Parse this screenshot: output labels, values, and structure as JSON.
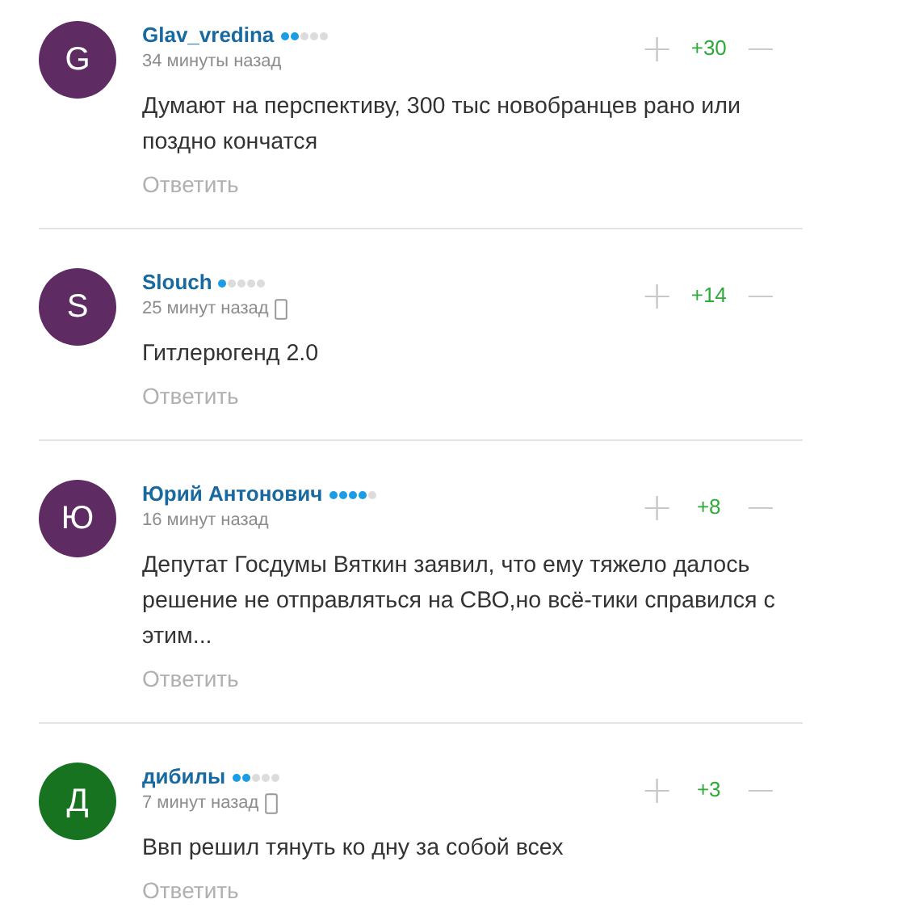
{
  "comments": [
    {
      "avatar": {
        "letter": "G",
        "color": "#5e2b63"
      },
      "author": "Glav_vredina",
      "stars": 2,
      "time": "34 минуты назад",
      "mobile": false,
      "votes": {
        "plus": "+",
        "score": "+30",
        "minus": "−"
      },
      "text": "Думают на перспективу, 300 тыс новобранцев рано или поздно кончатся",
      "reply": "Ответить"
    },
    {
      "avatar": {
        "letter": "S",
        "color": "#5e2b63"
      },
      "author": "Slouch",
      "stars": 1,
      "time": "25 минут назад",
      "mobile": true,
      "votes": {
        "plus": "+",
        "score": "+14",
        "minus": "−"
      },
      "text": "Гитлерюгенд 2.0",
      "reply": "Ответить"
    },
    {
      "avatar": {
        "letter": "Ю",
        "color": "#5e2b63"
      },
      "author": "Юрий Антонович",
      "stars": 4,
      "time": "16 минут назад",
      "mobile": false,
      "votes": {
        "plus": "+",
        "score": "+8",
        "minus": "−"
      },
      "text": "Депутат Госдумы Вяткин заявил, что ему тяжело далось решение не отправляться на СВО,но всё-тики справился с этим...",
      "reply": "Ответить"
    },
    {
      "avatar": {
        "letter": "Д",
        "color": "#17731f"
      },
      "author": "дибилы",
      "stars": 2,
      "time": "7 минут назад",
      "mobile": true,
      "votes": {
        "plus": "+",
        "score": "+3",
        "minus": "−"
      },
      "text": "Ввп решил тянуть ко дну за собой всех",
      "reply": "Ответить"
    }
  ]
}
